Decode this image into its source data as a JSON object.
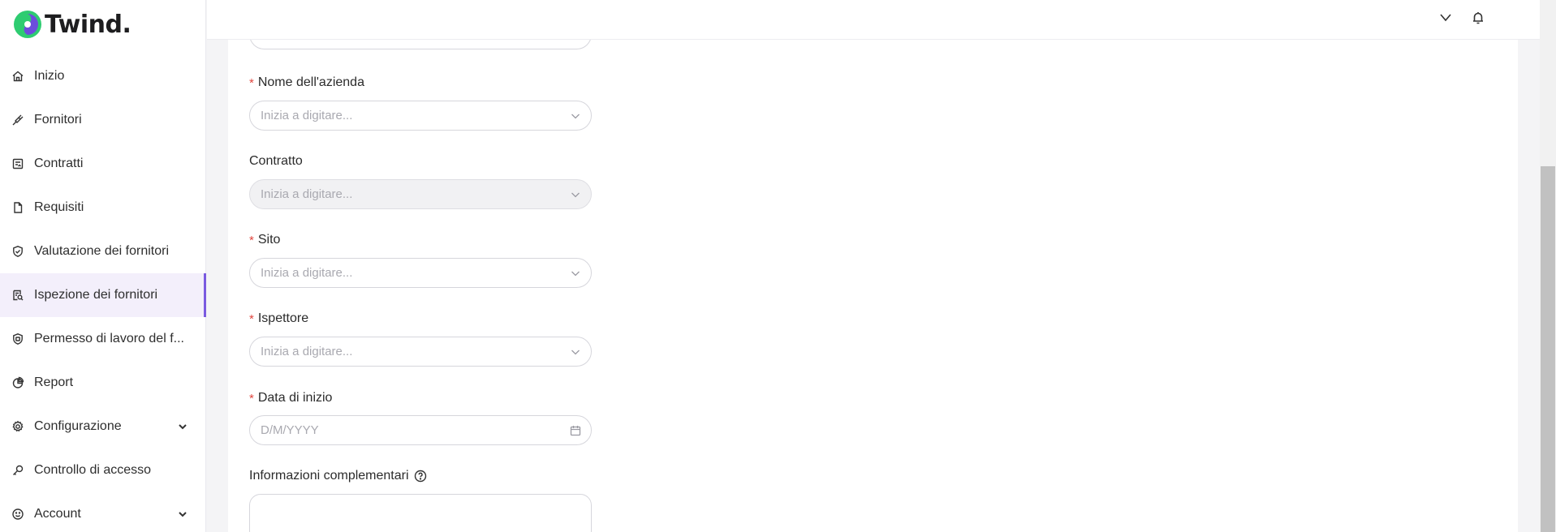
{
  "app": {
    "brand": "Twind.",
    "colors": {
      "accent": "#7a5ae0",
      "required": "#e0463e",
      "logo_green": "#2ecc71",
      "logo_purple": "#6c4cdc"
    }
  },
  "sidebar": {
    "items": [
      {
        "label": "Inizio",
        "icon": "home-icon"
      },
      {
        "label": "Fornitori",
        "icon": "plug-icon"
      },
      {
        "label": "Contratti",
        "icon": "contract-icon"
      },
      {
        "label": "Requisiti",
        "icon": "file-icon"
      },
      {
        "label": "Valutazione dei fornitori",
        "icon": "shield-check-icon"
      },
      {
        "label": "Ispezione dei fornitori",
        "icon": "inspect-icon",
        "active": true
      },
      {
        "label": "Permesso di lavoro del f...",
        "icon": "shield-badge-icon"
      },
      {
        "label": "Report",
        "icon": "pie-chart-icon"
      },
      {
        "label": "Configurazione",
        "icon": "gear-icon",
        "expandable": true
      },
      {
        "label": "Controllo di accesso",
        "icon": "key-icon"
      },
      {
        "label": "Account",
        "icon": "smile-icon",
        "expandable": true
      }
    ]
  },
  "topbar": {
    "icons": [
      "chevron-down-icon",
      "bell-icon"
    ]
  },
  "form": {
    "company_name": {
      "label": "Nome dell'azienda",
      "required": true,
      "placeholder": "Inizia a digitare..."
    },
    "contract": {
      "label": "Contratto",
      "required": false,
      "placeholder": "Inizia a digitare...",
      "disabled": true
    },
    "site": {
      "label": "Sito",
      "required": true,
      "placeholder": "Inizia a digitare..."
    },
    "inspector": {
      "label": "Ispettore",
      "required": true,
      "placeholder": "Inizia a digitare..."
    },
    "start_date": {
      "label": "Data di inizio",
      "required": true,
      "placeholder": "D/M/YYYY"
    },
    "additional_info": {
      "label": "Informazioni complementari",
      "value": ""
    },
    "required_marker": "*"
  }
}
